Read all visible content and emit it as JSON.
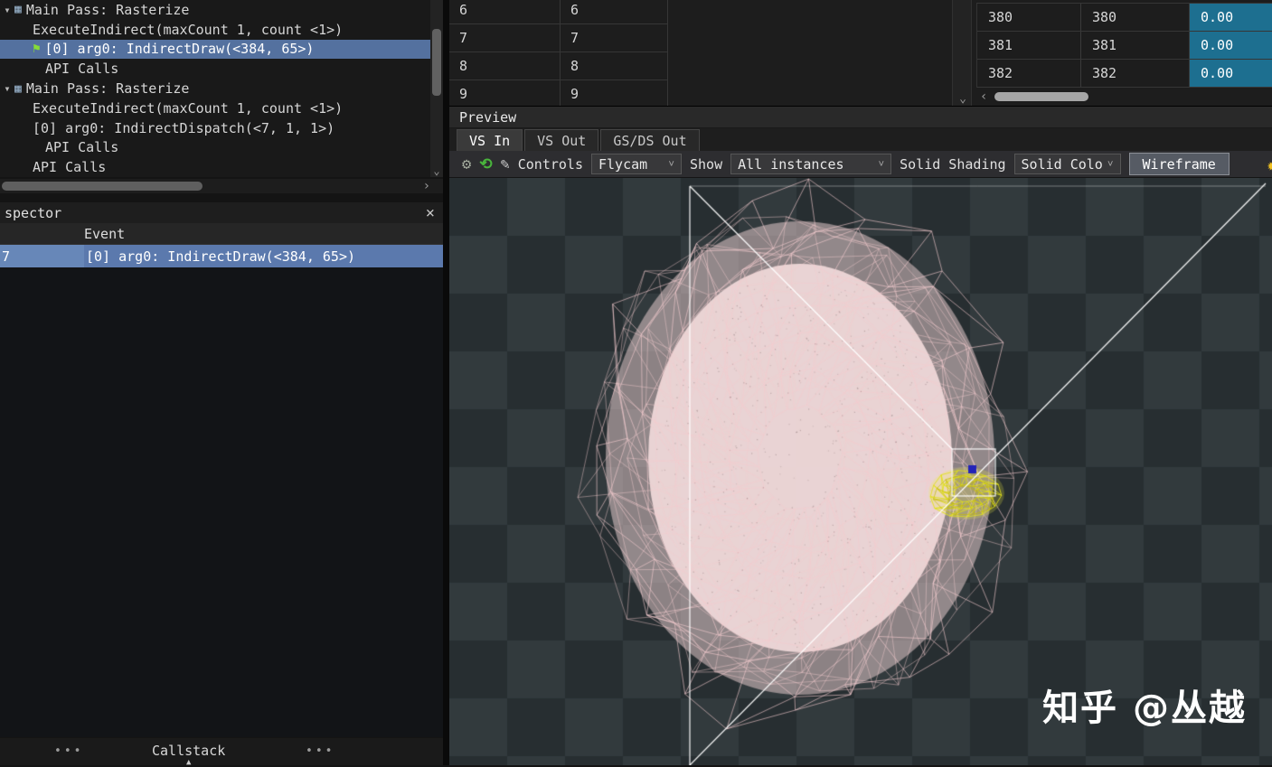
{
  "colors": {
    "selection_blue": "#54719f",
    "inspector_selection": "#5b79ad",
    "teal_cell": "#1d6f90",
    "mesh_pink": "#f3cdd0",
    "mesh_yellow": "#e2e21e",
    "accent_green": "#49b43c"
  },
  "event_browser": {
    "rows": [
      {
        "type": "pass",
        "label": "Main Pass: Rasterize"
      },
      {
        "type": "call",
        "indent": 2,
        "label": "ExecuteIndirect(maxCount 1, count <1>)"
      },
      {
        "type": "draw",
        "indent": 2,
        "selected": true,
        "label": "[0] arg0: IndirectDraw(<384, 65>)"
      },
      {
        "type": "call",
        "indent": 3,
        "label": "API Calls"
      },
      {
        "type": "pass",
        "label": "Main Pass: Rasterize"
      },
      {
        "type": "call",
        "indent": 2,
        "label": "ExecuteIndirect(maxCount 1, count <1>)"
      },
      {
        "type": "call",
        "indent": 2,
        "label": "[0] arg0: IndirectDispatch(<7, 1, 1>)"
      },
      {
        "type": "call",
        "indent": 3,
        "label": "API Calls"
      },
      {
        "type": "call",
        "indent": 2,
        "label": "API Calls"
      }
    ]
  },
  "inspector": {
    "title": "spector",
    "columns": {
      "event": "Event"
    },
    "selected_row": {
      "eid": "7",
      "event": "[0] arg0: IndirectDraw(<384, 65>)"
    }
  },
  "bottom_dock": {
    "tab": "Callstack",
    "dots": "•••"
  },
  "buffer_tables": {
    "left_rows": [
      [
        "6",
        "6"
      ],
      [
        "7",
        "7"
      ],
      [
        "8",
        "8"
      ],
      [
        "9",
        "9"
      ]
    ],
    "right_rows": [
      [
        "380",
        "380",
        "0.00"
      ],
      [
        "381",
        "381",
        "0.00"
      ],
      [
        "382",
        "382",
        "0.00"
      ]
    ]
  },
  "preview": {
    "title": "Preview",
    "tabs": [
      {
        "label": "VS In",
        "active": true
      },
      {
        "label": "VS Out",
        "active": false
      },
      {
        "label": "GS/DS Out",
        "active": false
      }
    ],
    "toolbar": {
      "controls_label": "Controls",
      "controls_value": "Flycam",
      "show_label": "Show",
      "show_value": "All instances",
      "shading_label": "Solid Shading",
      "shading_value": "Solid Colo",
      "wireframe_label": "Wireframe"
    }
  },
  "watermark": "知乎 @丛越",
  "icons": {
    "expand": "▾",
    "flag": "⚑",
    "pass": "▦",
    "close": "×",
    "gear": "⚙",
    "reset": "⟲",
    "pick": "✎",
    "dropdown": "˅",
    "scroll_right": "›",
    "scroll_down": "⌄",
    "scroll_left": "‹",
    "dock_up": "▲",
    "star": "✹"
  }
}
